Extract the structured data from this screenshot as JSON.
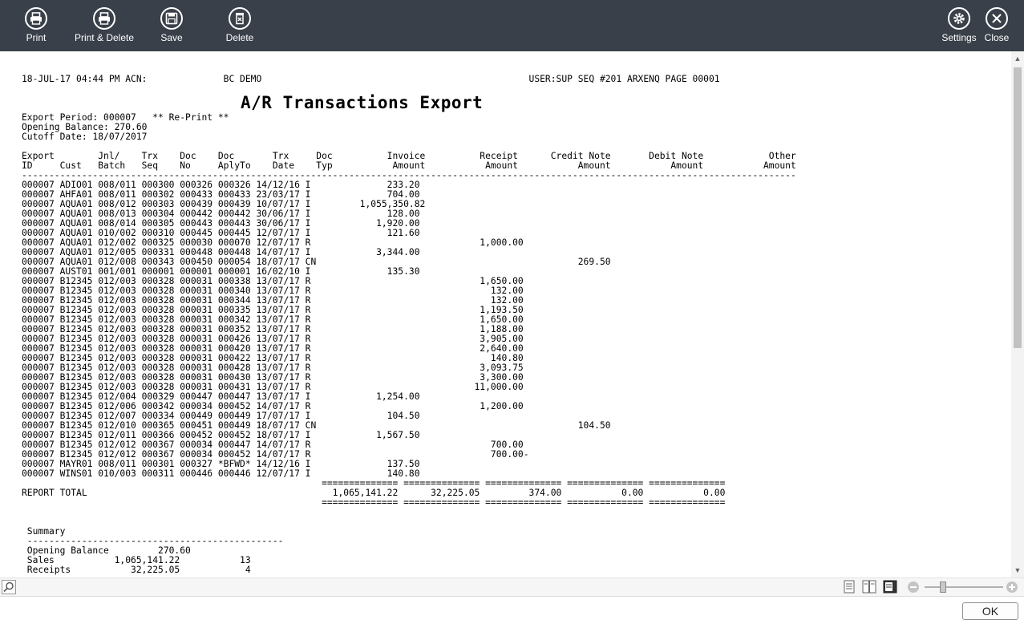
{
  "toolbar": {
    "print": "Print",
    "print_delete": "Print & Delete",
    "save": "Save",
    "delete": "Delete",
    "settings": "Settings",
    "close": "Close"
  },
  "report": {
    "title": "A/R Transactions Export",
    "header_line": "18-JUL-17 04:44 PM ACN:              BC DEMO                                                 USER:SUP SEQ #201 ARXENQ PAGE 00001",
    "period_line": "Export Period: 000007   ** Re-Print **",
    "opening_line": "Opening Balance: 270.60",
    "cutoff_line": "Cutoff Date: 18/07/2017",
    "col_head1": "Export        Jnl/    Trx    Doc    Doc       Trx     Doc          Invoice          Receipt      Credit Note       Debit Note            Other",
    "col_head2": "ID     Cust   Batch   Seq    No     AplyTo    Date    Typ           Amount           Amount           Amount           Amount           Amount",
    "dash_line": "----------------------------------------------------------------------------------------------------------------------------------------------",
    "rows": [
      "000007 ADIO01 008/011 000300 000326 000326 14/12/16 I              233.20",
      "000007 AHFA01 008/011 000302 000433 000433 23/03/17 I              704.00",
      "000007 AQUA01 008/012 000303 000439 000439 10/07/17 I         1,055,350.82",
      "000007 AQUA01 008/013 000304 000442 000442 30/06/17 I              128.00",
      "000007 AQUA01 008/014 000305 000443 000443 30/06/17 I            1,920.00",
      "000007 AQUA01 010/002 000310 000445 000445 12/07/17 I              121.60",
      "000007 AQUA01 012/002 000325 000030 000070 12/07/17 R                               1,000.00",
      "000007 AQUA01 012/005 000331 000448 000448 14/07/17 I            3,344.00",
      "000007 AQUA01 012/008 000343 000450 000054 18/07/17 CN                                                269.50",
      "000007 AUST01 001/001 000001 000001 000001 16/02/10 I              135.30",
      "000007 B12345 012/003 000328 000031 000338 13/07/17 R                               1,650.00",
      "000007 B12345 012/003 000328 000031 000340 13/07/17 R                                 132.00",
      "000007 B12345 012/003 000328 000031 000344 13/07/17 R                                 132.00",
      "000007 B12345 012/003 000328 000031 000335 13/07/17 R                               1,193.50",
      "000007 B12345 012/003 000328 000031 000342 13/07/17 R                               1,650.00",
      "000007 B12345 012/003 000328 000031 000352 13/07/17 R                               1,188.00",
      "000007 B12345 012/003 000328 000031 000426 13/07/17 R                               3,905.00",
      "000007 B12345 012/003 000328 000031 000420 13/07/17 R                               2,640.00",
      "000007 B12345 012/003 000328 000031 000422 13/07/17 R                                 140.80",
      "000007 B12345 012/003 000328 000031 000428 13/07/17 R                               3,093.75",
      "000007 B12345 012/003 000328 000031 000430 13/07/17 R                               3,300.00",
      "000007 B12345 012/003 000328 000031 000431 13/07/17 R                              11,000.00",
      "000007 B12345 012/004 000329 000447 000447 13/07/17 I            1,254.00",
      "000007 B12345 012/006 000342 000034 000452 14/07/17 R                               1,200.00",
      "000007 B12345 012/007 000334 000449 000449 17/07/17 I              104.50",
      "000007 B12345 012/010 000365 000451 000449 18/07/17 CN                                                104.50",
      "000007 B12345 012/011 000366 000452 000452 18/07/17 I            1,567.50",
      "000007 B12345 012/012 000367 000034 000447 14/07/17 R                                 700.00",
      "000007 B12345 012/012 000367 000034 000452 14/07/17 R                                 700.00-",
      "000007 MAYR01 008/011 000301 000327 *BFWD* 14/12/16 I              137.50",
      "000007 WINS01 010/003 000311 000446 000446 12/07/17 I              140.80"
    ],
    "eq_line": "                                                       ============== ============== ============== ============== ==============",
    "total_line": "REPORT TOTAL                                             1,065,141.22      32,225.05         374.00           0.00           0.00",
    "summary_label": " Summary",
    "summary_dash": " -----------------------------------------------",
    "summary_rows": [
      " Opening Balance         270.60",
      " Sales           1,065,141.22           13",
      " Receipts           32,225.05            4"
    ]
  },
  "footer": {
    "ok": "OK"
  }
}
